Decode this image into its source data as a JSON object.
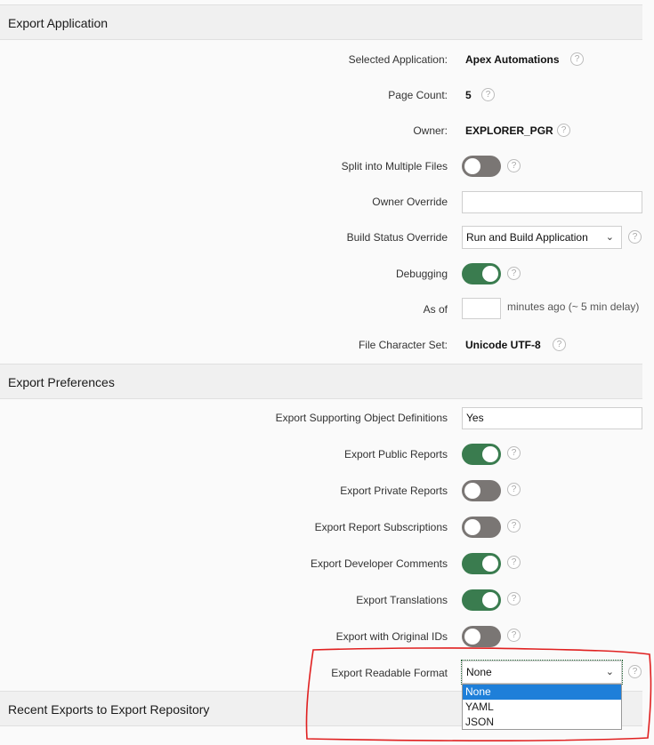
{
  "export_application": {
    "title": "Export Application",
    "selected_application": {
      "label": "Selected Application:",
      "value": "Apex Automations"
    },
    "page_count": {
      "label": "Page Count:",
      "value": "5"
    },
    "owner": {
      "label": "Owner:",
      "value": "EXPLORER_PGR"
    },
    "split_files": {
      "label": "Split into Multiple Files",
      "state": "off"
    },
    "owner_override": {
      "label": "Owner Override",
      "value": ""
    },
    "build_status": {
      "label": "Build Status Override",
      "value": "Run and Build Application"
    },
    "debugging": {
      "label": "Debugging",
      "state": "on"
    },
    "as_of": {
      "label": "As of",
      "value": "",
      "suffix": "minutes ago (~ 5 min delay)"
    },
    "file_charset": {
      "label": "File Character Set:",
      "value": "Unicode UTF-8"
    }
  },
  "export_preferences": {
    "title": "Export Preferences",
    "supporting_objects": {
      "label": "Export Supporting Object Definitions",
      "value": "Yes"
    },
    "public_reports": {
      "label": "Export Public Reports",
      "state": "on"
    },
    "private_reports": {
      "label": "Export Private Reports",
      "state": "off"
    },
    "report_subscriptions": {
      "label": "Export Report Subscriptions",
      "state": "off"
    },
    "developer_comments": {
      "label": "Export Developer Comments",
      "state": "on"
    },
    "translations": {
      "label": "Export Translations",
      "state": "on"
    },
    "original_ids": {
      "label": "Export with Original IDs",
      "state": "off"
    },
    "readable_format": {
      "label": "Export Readable Format",
      "value": "None",
      "options": [
        "None",
        "YAML",
        "JSON"
      ],
      "highlighted": "None"
    }
  },
  "recent_exports": {
    "title": "Recent Exports to Export Repository"
  },
  "icons": {
    "help": "?",
    "chevron": "⌵"
  },
  "colors": {
    "toggle_on": "#3a7c4f",
    "toggle_off": "#7a7674",
    "annotation": "#e02020",
    "option_selected": "#1e7fd9"
  }
}
